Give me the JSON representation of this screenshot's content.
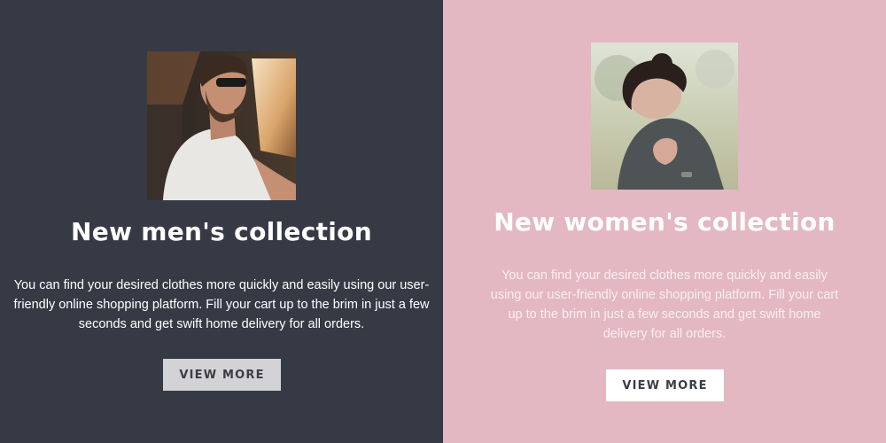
{
  "men": {
    "title": "New men's collection",
    "description": "You can find your desired clothes more quickly and easily using our user-friendly online shopping platform. Fill your cart up to the brim in just a few seconds and get swift home delivery for all orders.",
    "button_label": "VIEW MORE",
    "image_alt": "man-in-car-photo"
  },
  "women": {
    "title": "New women's collection",
    "description": "You can find your desired clothes more quickly and easily using our user-friendly online shopping platform. Fill your cart up to the brim in just a few seconds and get swift home delivery for all orders.",
    "button_label": "VIEW MORE",
    "image_alt": "woman-outdoors-photo"
  },
  "colors": {
    "men_bg": "#363a45",
    "women_bg": "#e3b8c3",
    "men_button_bg": "#d3d3d5",
    "women_button_bg": "#ffffff"
  }
}
